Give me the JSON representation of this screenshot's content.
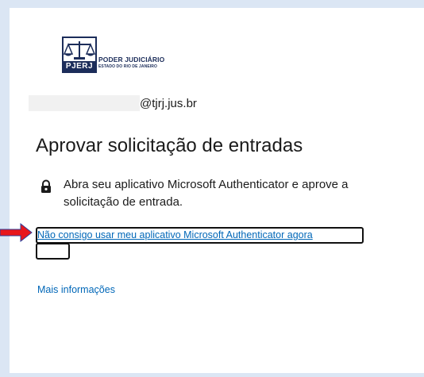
{
  "logo": {
    "org_name": "PODER JUDICIÁRIO",
    "org_subtitle": "ESTADO DO RIO DE JANEIRO",
    "monogram": "PJERJ"
  },
  "account": {
    "domain": "@tjrj.jus.br"
  },
  "page_title": "Aprovar solicitação de entradas",
  "instruction": {
    "icon": "lock-icon",
    "text": "Abra seu aplicativo Microsoft Authenticator e aprove a solicitação de entrada."
  },
  "links": {
    "cannot_use_app": "Não consigo usar meu aplicativo Microsoft Authenticator agora",
    "more_info": "Mais informações"
  },
  "annotation": {
    "arrow_color": "#e8161b",
    "highlight_color": "#111111"
  },
  "colors": {
    "link": "#0067b8",
    "text": "#1b1b1b",
    "background": "#dbe6f4"
  }
}
